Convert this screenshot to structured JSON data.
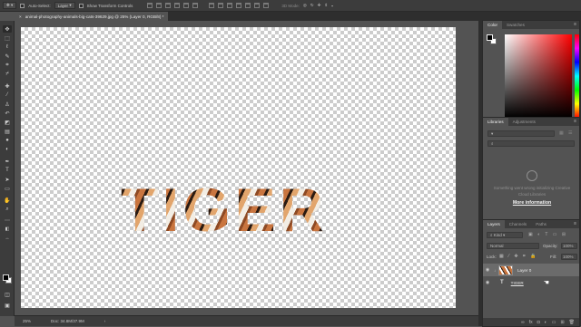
{
  "options_bar": {
    "auto_select_label": "Auto-Select:",
    "auto_select_value": "Layer",
    "show_transform_label": "Show Transform Controls",
    "mode_label": "3D Mode:"
  },
  "document": {
    "tab_title": "animal-photography-animals-big-cats-39629.jpg @ 25% (Layer 0, RGB/8) *",
    "close_glyph": "×",
    "canvas_text": "TIGER"
  },
  "status": {
    "zoom": "25%",
    "doc_size": "Doc: 34.8M/37.9M"
  },
  "color_panel": {
    "tabs": [
      "Color",
      "Swatches"
    ]
  },
  "libraries_panel": {
    "tabs": [
      "Libraries",
      "Adjustments"
    ],
    "message": "Something went wrong initializing Creative Cloud Libraries",
    "link": "More information"
  },
  "layers_panel": {
    "tabs": [
      "Layers",
      "Channels",
      "Paths"
    ],
    "kind_filter": "Kind",
    "blend_mode": "Normal",
    "opacity_label": "Opacity:",
    "opacity_value": "100%",
    "lock_label": "Lock:",
    "fill_label": "Fill:",
    "fill_value": "100%",
    "layers": [
      {
        "name": "Layer 0",
        "type": "image"
      },
      {
        "name": "TIGER",
        "type": "text"
      }
    ],
    "footer_icons": [
      "link-icon",
      "fx-icon",
      "mask-icon",
      "adjustment-icon",
      "folder-icon",
      "new-layer-icon",
      "trash-icon"
    ]
  },
  "tools": [
    "move",
    "marquee",
    "lasso",
    "quick-select",
    "crop",
    "eyedropper",
    "healing",
    "brush",
    "stamp",
    "history-brush",
    "eraser",
    "gradient",
    "blur",
    "dodge",
    "pen",
    "type",
    "path-select",
    "shape",
    "hand",
    "zoom"
  ],
  "colors": {
    "foreground": "#000000",
    "background": "#ffffff"
  }
}
